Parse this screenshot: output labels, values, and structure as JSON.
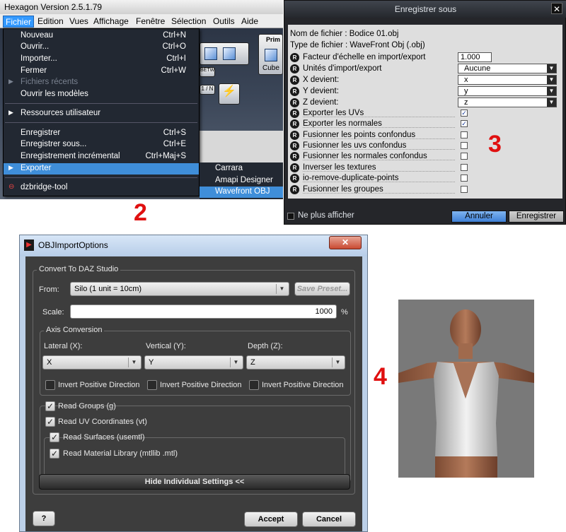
{
  "hexagon": {
    "window_title": "Hexagon Version 2.5.1.79",
    "menubar": [
      "Fichier",
      "Edition",
      "Vues",
      "Affichage",
      "Fenêtre",
      "Sélection",
      "Outils",
      "Aide"
    ],
    "toolbar": {
      "prim_tab": "Prim",
      "betw_label": "BETW",
      "in_label": "1 / N",
      "cube_label": "Cube"
    },
    "file_menu": [
      {
        "label": "Nouveau",
        "shortcut": "Ctrl+N"
      },
      {
        "label": "Ouvrir...",
        "shortcut": "Ctrl+O"
      },
      {
        "label": "Importer...",
        "shortcut": "Ctrl+I"
      },
      {
        "label": "Fermer",
        "shortcut": "Ctrl+W"
      },
      {
        "label": "Fichiers récents",
        "shortcut": ""
      },
      {
        "label": "Ouvrir les modèles",
        "shortcut": ""
      },
      {
        "label": "Ressources utilisateur",
        "shortcut": ""
      },
      {
        "label": "Enregistrer",
        "shortcut": "Ctrl+S"
      },
      {
        "label": "Enregistrer sous...",
        "shortcut": "Ctrl+E"
      },
      {
        "label": "Enregistrement incrémental",
        "shortcut": "Ctrl+Maj+S"
      },
      {
        "label": "Exporter",
        "shortcut": ""
      },
      {
        "label": "dzbridge-tool",
        "shortcut": ""
      }
    ],
    "export_submenu": [
      "Carrara",
      "Amapi Designer",
      "Wavefront OBJ"
    ]
  },
  "markers": {
    "two": "2",
    "three": "3",
    "four": "4"
  },
  "save_dialog": {
    "title": "Enregistrer sous",
    "close": "✕",
    "filename_line": "Nom de fichier : Bodice 01.obj",
    "filetype_line": "Type de fichier : WaveFront Obj  (.obj)",
    "reset_glyph": "R",
    "scale_label": "Facteur d'échelle en import/export",
    "scale_value": "1.000",
    "units_label": "Unités d'import/export",
    "units_value": "Aucune",
    "x_label": "X devient:",
    "x_value": "x",
    "y_label": "Y devient:",
    "y_value": "y",
    "z_label": "Z devient:",
    "z_value": "z",
    "options": [
      {
        "label": "Exporter les UVs",
        "checked": true
      },
      {
        "label": "Exporter les normales",
        "checked": true
      },
      {
        "label": "Fusionner les points confondus",
        "checked": false
      },
      {
        "label": "Fusionner les uvs confondus",
        "checked": false
      },
      {
        "label": "Fusionner les normales confondus",
        "checked": false
      },
      {
        "label": "Inverser les textures",
        "checked": false
      },
      {
        "label": "io-remove-duplicate-points",
        "checked": false
      },
      {
        "label": "Fusionner les groupes",
        "checked": false
      }
    ],
    "checkmark": "✓",
    "dropdown_glyph": "▼",
    "dont_show": "Ne plus afficher",
    "cancel_button": "Annuler",
    "save_button": "Enregistrer"
  },
  "obj_dialog": {
    "title": "OBJImportOptions",
    "close": "✕",
    "app_icon": "▶",
    "group_convert": "Convert To DAZ Studio",
    "from_label": "From:",
    "from_value": "Silo (1 unit = 10cm)",
    "save_preset": "Save Preset...",
    "scale_label": "Scale:",
    "scale_value": "1000",
    "scale_unit": "%",
    "group_axis": "Axis Conversion",
    "lateral_label": "Lateral (X):",
    "lateral_value": "X",
    "vertical_label": "Vertical (Y):",
    "vertical_value": "Y",
    "depth_label": "Depth (Z):",
    "depth_value": "Z",
    "invert_label": "Invert Positive Direction",
    "read_groups": "Read Groups (g)",
    "read_uv": "Read UV Coordinates (vt)",
    "read_surfaces": "Read Surfaces (usemtl)",
    "read_material": "Read Material Library (mtllib .mtl)",
    "hide_settings": "Hide Individual Settings <<",
    "help": "?",
    "accept": "Accept",
    "cancel": "Cancel"
  },
  "colors": {
    "menu_highlight": "#3f8ed9",
    "marker_red": "#e01010",
    "annuler_blue": "#4a8fde"
  }
}
